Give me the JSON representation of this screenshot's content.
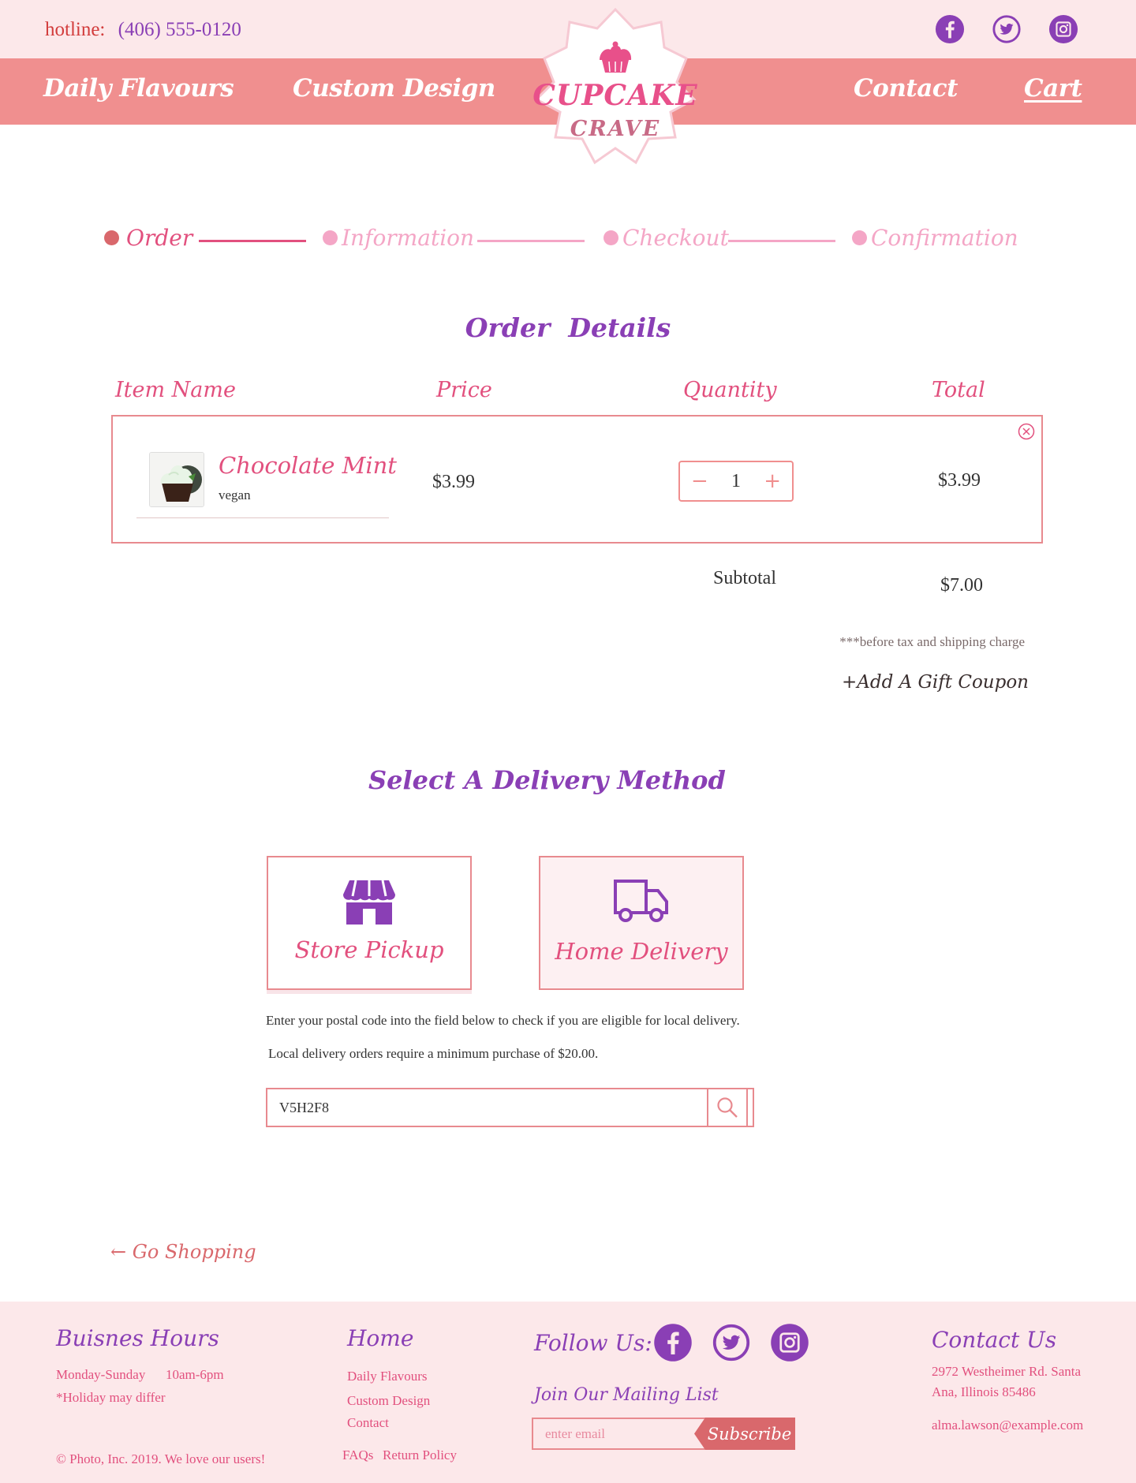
{
  "header": {
    "hotline_label": "hotline:",
    "hotline_number": "(406) 555-0120",
    "social": [
      "facebook-icon",
      "twitter-icon",
      "instagram-icon"
    ]
  },
  "nav": {
    "daily_flavours": "Daily Flavours",
    "custom_design": "Custom Design",
    "contact": "Contact",
    "cart": "Cart"
  },
  "logo": {
    "line1": "CUPCAKE",
    "line2": "CRAVE"
  },
  "steps": [
    {
      "label": "Order",
      "active": true
    },
    {
      "label": "Information",
      "active": false
    },
    {
      "label": "Checkout",
      "active": false
    },
    {
      "label": "Confirmation",
      "active": false
    }
  ],
  "order": {
    "title": "Order  Details",
    "columns": {
      "item_name": "Item Name",
      "price": "Price",
      "quantity": "Quantity",
      "total": "Total"
    },
    "items": [
      {
        "name": "Chocolate Mint",
        "tag": "vegan",
        "price": "$3.99",
        "quantity": "1",
        "total": "$3.99"
      }
    ],
    "subtotal_label": "Subtotal",
    "subtotal_value": "$7.00",
    "tax_note": "***before tax and shipping charge",
    "coupon": "+Add A Gift Coupon"
  },
  "delivery": {
    "title": "Select A Delivery Method",
    "options": [
      {
        "label": "Store Pickup",
        "icon": "store-icon",
        "selected": false
      },
      {
        "label": "Home Delivery",
        "icon": "truck-icon",
        "selected": true
      }
    ],
    "info1": "Enter your postal code into the field below to check if you are eligible for local delivery.",
    "info2": "Local delivery orders require a minimum purchase of $20.00.",
    "postal_value": "V5H2F8"
  },
  "go_shopping": "← Go Shopping",
  "footer": {
    "hours_title": "Buisnes Hours",
    "hours_days": "Monday-Sunday",
    "hours_time": "10am-6pm",
    "holiday": "*Holiday may differ",
    "copyright": "© Photo, Inc. 2019. We love our users!",
    "home_title": "Home",
    "home_links": [
      "Daily Flavours",
      "Custom Design",
      "Contact"
    ],
    "faqs": "FAQs",
    "return_policy": "Return Policy",
    "follow_title": "Follow Us:",
    "mailing_title": "Join Our Mailing List",
    "email_placeholder": "enter email",
    "subscribe": "Subscribe",
    "contact_title": "Contact Us",
    "address_line1": "2972 Westheimer Rd. Santa",
    "address_line2": "Ana, Illinois 85486",
    "email": "alma.lawson@example.com"
  },
  "colors": {
    "pink_bg": "#fce8ea",
    "nav_salmon": "#f08f8f",
    "accent_pink": "#e2507e",
    "purple": "#8a3fb5",
    "border_pink": "#e88a8f"
  }
}
